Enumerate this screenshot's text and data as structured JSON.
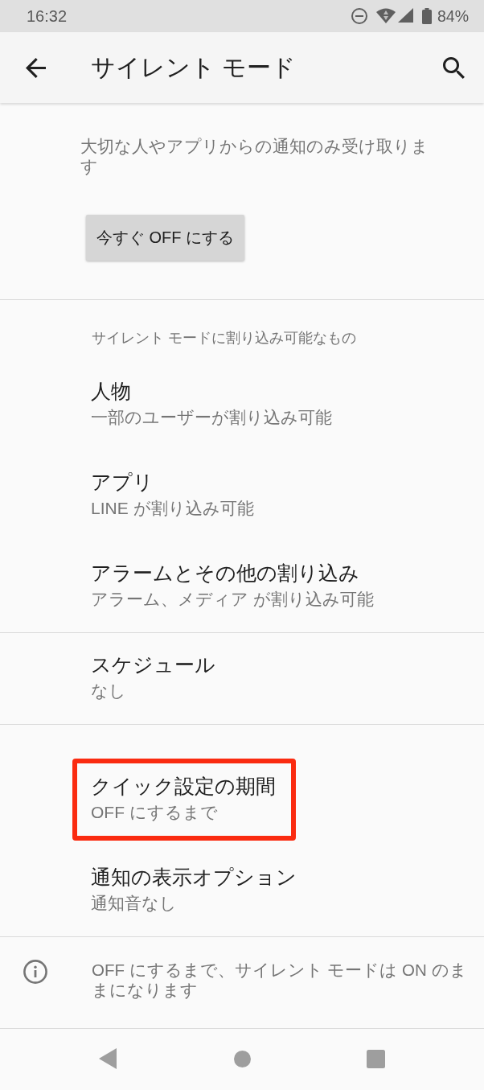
{
  "status_bar": {
    "time": "16:32",
    "battery": "84%"
  },
  "app_bar": {
    "title": "サイレント モード"
  },
  "intro": {
    "description": "大切な人やアプリからの通知のみ受け取ります",
    "button": "今すぐ OFF にする"
  },
  "groups": [
    {
      "header": "サイレント モードに割り込み可能なもの",
      "items": [
        {
          "title": "人物",
          "summary": "一部のユーザーが割り込み可能",
          "highlighted": false
        },
        {
          "title": "アプリ",
          "summary": "LINE が割り込み可能",
          "highlighted": false
        },
        {
          "title": "アラームとその他の割り込み",
          "summary": "アラーム、メディア が割り込み可能",
          "highlighted": false
        }
      ]
    },
    {
      "items": [
        {
          "title": "スケジュール",
          "summary": "なし",
          "highlighted": false
        }
      ]
    },
    {
      "items": [
        {
          "title": "クイック設定の期間",
          "summary": "OFF にするまで",
          "highlighted": true
        },
        {
          "title": "通知の表示オプション",
          "summary": "通知音なし",
          "highlighted": false
        }
      ]
    }
  ],
  "footer_info": {
    "text": "OFF にするまで、サイレント モードは ON のままになります"
  }
}
